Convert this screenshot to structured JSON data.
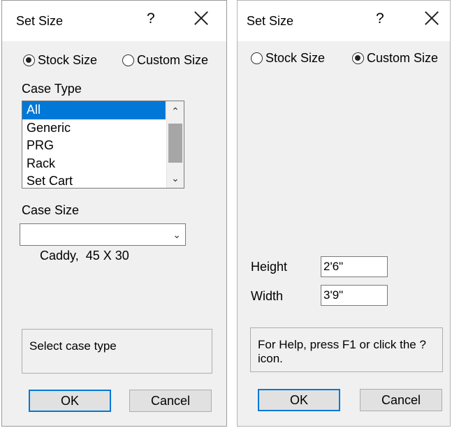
{
  "left_dialog": {
    "title": "Set Size",
    "help_glyph": "?",
    "radio_stock": "Stock Size",
    "radio_custom": "Custom Size",
    "selected_radio": "stock",
    "case_type_label": "Case Type",
    "case_types": [
      "All",
      "Generic",
      "PRG",
      "Rack",
      "Set Cart"
    ],
    "selected_case_type": "All",
    "case_size_label": "Case Size",
    "case_size_value": "Caddy,  45 X 30",
    "status_text": "Select case type",
    "ok_label": "OK",
    "cancel_label": "Cancel"
  },
  "right_dialog": {
    "title": "Set Size",
    "help_glyph": "?",
    "radio_stock": "Stock Size",
    "radio_custom": "Custom Size",
    "selected_radio": "custom",
    "height_label": "Height",
    "height_value": "2'6\"",
    "width_label": "Width",
    "width_value": "3'9\"",
    "status_text": "For Help, press F1 or click the ? icon.",
    "ok_label": "OK",
    "cancel_label": "Cancel"
  },
  "icons": {
    "close": "close-icon",
    "help": "help-icon",
    "scroll_up": "chevron-up-icon",
    "scroll_down": "chevron-down-icon",
    "combo_dropdown": "chevron-down-icon"
  },
  "colors": {
    "selection": "#0078d7",
    "dialog_bg": "#f0f0f0",
    "titlebar_bg": "#ffffff"
  }
}
